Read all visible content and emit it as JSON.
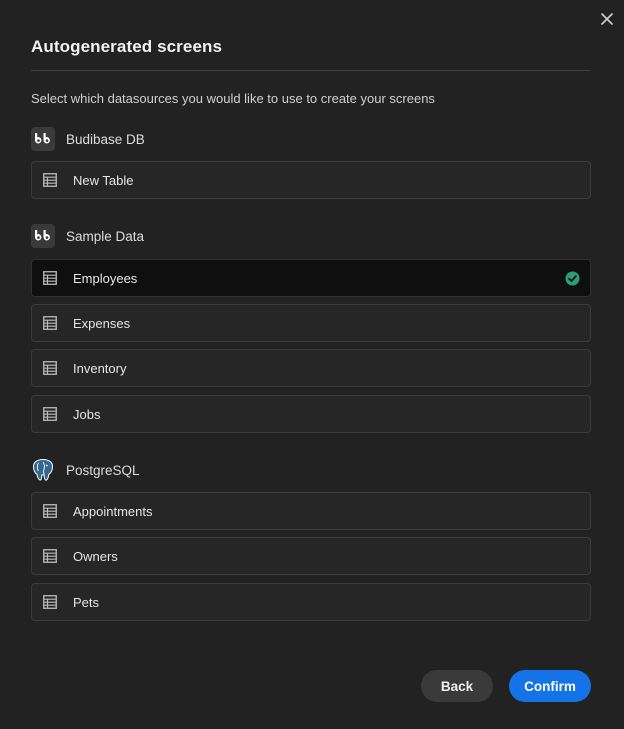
{
  "dialog": {
    "title": "Autogenerated screens",
    "subtitle": "Select which datasources you would like to use to create your screens"
  },
  "groups": [
    {
      "name": "Budibase DB",
      "logo": "bb-logo-icon",
      "tables": [
        {
          "label": "New Table",
          "selected": false
        }
      ]
    },
    {
      "name": "Sample Data",
      "logo": "bb-logo-icon",
      "tables": [
        {
          "label": "Employees",
          "selected": true
        },
        {
          "label": "Expenses",
          "selected": false
        },
        {
          "label": "Inventory",
          "selected": false
        },
        {
          "label": "Jobs",
          "selected": false
        }
      ]
    },
    {
      "name": "PostgreSQL",
      "logo": "postgresql-elephant-icon",
      "tables": [
        {
          "label": "Appointments",
          "selected": false
        },
        {
          "label": "Owners",
          "selected": false
        },
        {
          "label": "Pets",
          "selected": false
        }
      ]
    }
  ],
  "actions": {
    "back_label": "Back",
    "confirm_label": "Confirm"
  },
  "colors": {
    "background": "#222222",
    "row": "#262626",
    "row_selected": "#0f0f0f",
    "accent": "#1473e6",
    "check": "#2d9d78"
  }
}
